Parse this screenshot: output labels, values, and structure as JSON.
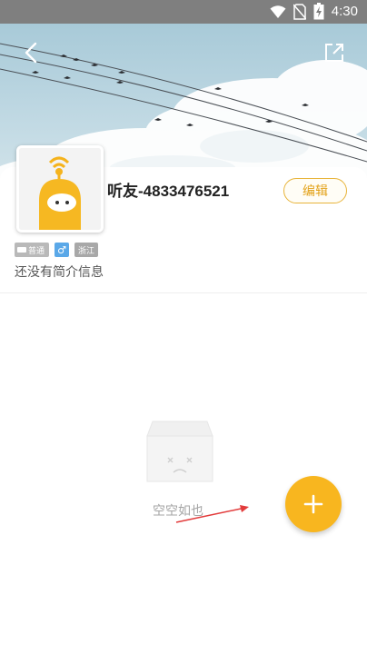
{
  "status_bar": {
    "time": "4:30"
  },
  "profile": {
    "nickname": "听友-4833476521",
    "edit_label": "编辑",
    "tags": {
      "level": "普通",
      "gender": "♂",
      "region": "浙江"
    },
    "bio": "还没有简介信息"
  },
  "empty_state": {
    "text": "空空如也"
  },
  "icons": {
    "back": "back-arrow-icon",
    "share": "share-icon",
    "add": "plus-icon",
    "wifi": "wifi-icon",
    "no_signal": "no-sim-icon",
    "battery": "battery-icon"
  },
  "colors": {
    "accent": "#f8b61f",
    "edit_border": "#e8b43a",
    "gender_tag": "#5aa8e8"
  }
}
